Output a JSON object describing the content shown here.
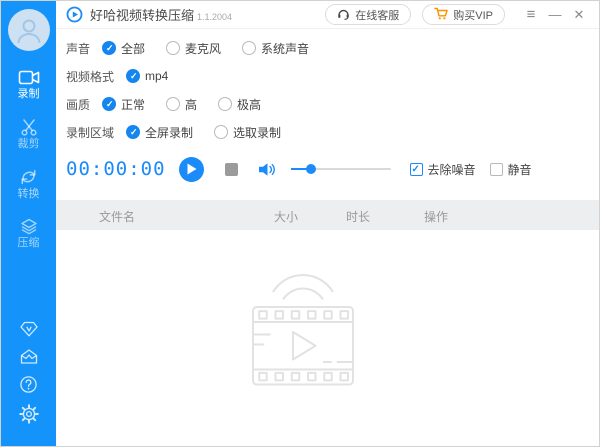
{
  "titlebar": {
    "app_title": "好哈视频转换压缩",
    "version": "1.1.2004",
    "support_label": "在线客服",
    "vip_label": "购买VIP",
    "menu_glyph": "≡",
    "minimize_glyph": "—",
    "close_glyph": "✕"
  },
  "sidebar": {
    "items": [
      {
        "icon": "camera-icon",
        "label": "录制",
        "active": true
      },
      {
        "icon": "scissors-icon",
        "label": "裁剪",
        "active": false
      },
      {
        "icon": "convert-icon",
        "label": "转换",
        "active": false
      },
      {
        "icon": "layers-icon",
        "label": "压缩",
        "active": false
      }
    ],
    "bottom_icons": [
      "vip-diamond-icon",
      "mail-icon",
      "help-icon",
      "settings-icon"
    ]
  },
  "options": {
    "rows": [
      {
        "label": "声音",
        "options": [
          {
            "label": "全部",
            "checked": true
          },
          {
            "label": "麦克风",
            "checked": false
          },
          {
            "label": "系统声音",
            "checked": false
          }
        ]
      },
      {
        "label": "视频格式",
        "options": [
          {
            "label": "mp4",
            "checked": true
          }
        ]
      },
      {
        "label": "画质",
        "options": [
          {
            "label": "正常",
            "checked": true
          },
          {
            "label": "高",
            "checked": false
          },
          {
            "label": "极高",
            "checked": false
          }
        ]
      },
      {
        "label": "录制区域",
        "options": [
          {
            "label": "全屏录制",
            "checked": true
          },
          {
            "label": "选取录制",
            "checked": false
          }
        ]
      }
    ]
  },
  "recorder": {
    "timer": "00:00:00",
    "volume_percent": 20,
    "noise_label": "去除噪音",
    "noise_checked": true,
    "mute_label": "静音",
    "mute_checked": false
  },
  "table": {
    "columns": [
      "文件名",
      "大小",
      "时长",
      "操作"
    ]
  },
  "colors": {
    "sidebar_blue": "#1493fb",
    "accent_blue": "#1b8bf9",
    "vip_orange": "#ff9000",
    "table_header_bg": "#edeef0"
  }
}
